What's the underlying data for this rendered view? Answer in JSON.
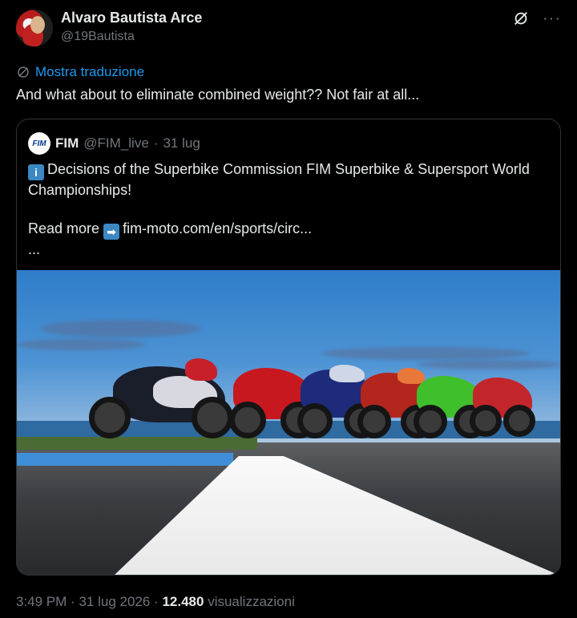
{
  "author": {
    "name": "Alvaro Bautista Arce",
    "handle": "@19Bautista"
  },
  "tweet": {
    "translate_label": "Mostra traduzione",
    "text": "And what about to eliminate combined weight?? Not fair at all..."
  },
  "quote": {
    "logo_text": "FIM",
    "name": "FIM",
    "handle": "@FIM_live",
    "separator": "·",
    "date": "31 lug",
    "info_emoji": "i",
    "line1": "Decisions of the Superbike Commission FIM Superbike & Supersport World Championships!",
    "read_more": "Read more",
    "arrow_emoji": "➡",
    "link": "fim-moto.com/en/sports/circ...",
    "ellipsis": "..."
  },
  "meta": {
    "time": "3:49 PM",
    "sep1": "·",
    "date": "31 lug 2026",
    "sep2": "·",
    "views": "12.480",
    "views_label": "visualizzazioni"
  },
  "colors": {
    "background": "#000000",
    "text": "#e7e9ea",
    "muted": "#71767b",
    "link": "#1d9bf0",
    "border": "#2f3336"
  },
  "icons": {
    "grok": "grok-icon",
    "more": "more-icon",
    "translate": "translate-icon",
    "info": "info-icon",
    "arrow": "arrow-right-icon"
  }
}
